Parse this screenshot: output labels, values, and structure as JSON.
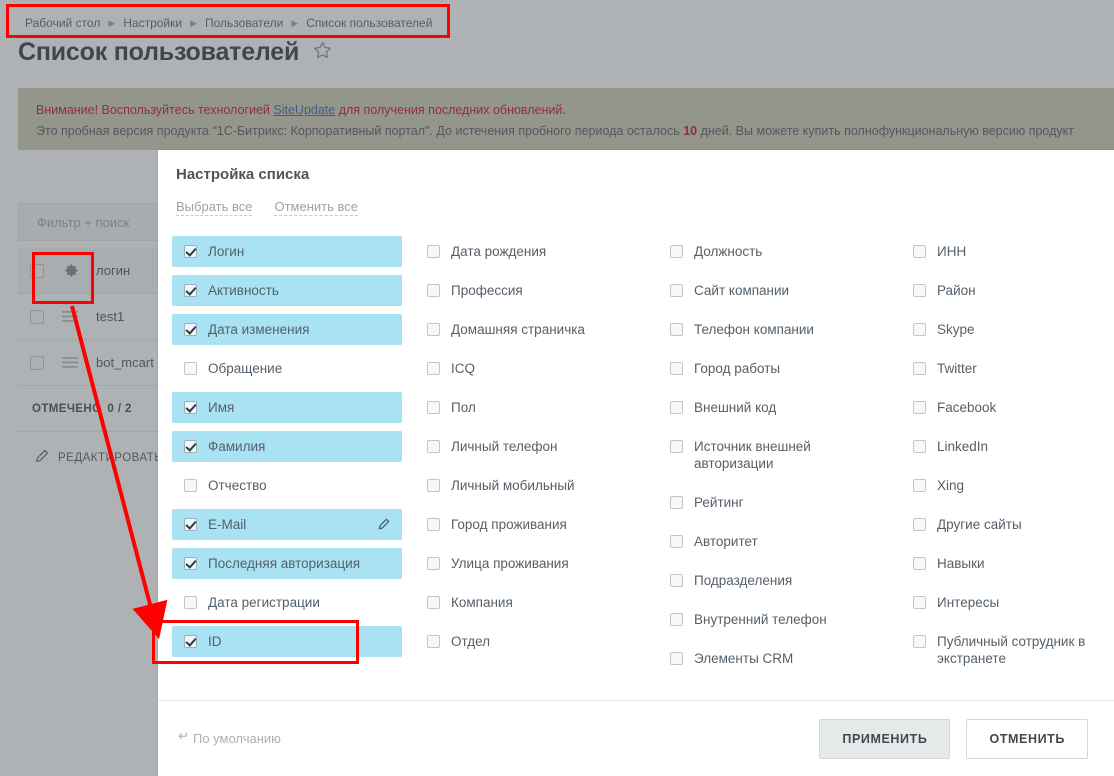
{
  "breadcrumb": {
    "items": [
      {
        "label": "Рабочий стол"
      },
      {
        "label": "Настройки"
      },
      {
        "label": "Пользователи"
      },
      {
        "label": "Список пользователей"
      }
    ],
    "separator": "▶"
  },
  "header": {
    "title": "Список пользователей",
    "favorite_icon": "star-icon"
  },
  "warning": {
    "line1_prefix": "Внимание! Воспользуйтесь технологией ",
    "line1_link": "SiteUpdate",
    "line1_suffix": " для получения последних обновлений.",
    "line2_prefix": "Это пробная версия продукта \"1С-Битрикс: Корпоративный портал\". До истечения пробного периода осталось ",
    "line2_days": "10",
    "line2_suffix": " дней. Вы можете купить полнофункциональную версию продукт"
  },
  "background_table": {
    "filter_placeholder": "Фильтр + поиск",
    "header_gear_icon": "gear-icon",
    "header_login_label": "логин",
    "rows": [
      {
        "grip_icon": "grip-icon",
        "login": "test1"
      },
      {
        "grip_icon": "grip-icon",
        "login": "bot_mcart"
      }
    ],
    "marked_label": "ОТМЕЧЕНО",
    "marked_count": "0 / 2",
    "edit_icon": "pencil-icon",
    "edit_label": "РЕДАКТИРОВАТЬ"
  },
  "dialog": {
    "title": "Настройка списка",
    "select_all": "Выбрать все",
    "deselect_all": "Отменить все",
    "columns": [
      {
        "options": [
          {
            "label": "Логин",
            "checked": true
          },
          {
            "label": "Активность",
            "checked": true
          },
          {
            "label": "Дата изменения",
            "checked": true
          },
          {
            "label": "Обращение",
            "checked": false
          },
          {
            "label": "Имя",
            "checked": true
          },
          {
            "label": "Фамилия",
            "checked": true
          },
          {
            "label": "Отчество",
            "checked": false
          },
          {
            "label": "E-Mail",
            "checked": true,
            "icon": "pencil-icon"
          },
          {
            "label": "Последняя авторизация",
            "checked": true
          },
          {
            "label": "Дата регистрации",
            "checked": false
          },
          {
            "label": "ID",
            "checked": true
          }
        ]
      },
      {
        "options": [
          {
            "label": "Дата рождения",
            "checked": false
          },
          {
            "label": "Профессия",
            "checked": false
          },
          {
            "label": "Домашняя страничка",
            "checked": false
          },
          {
            "label": "ICQ",
            "checked": false
          },
          {
            "label": "Пол",
            "checked": false
          },
          {
            "label": "Личный телефон",
            "checked": false
          },
          {
            "label": "Личный мобильный",
            "checked": false
          },
          {
            "label": "Город проживания",
            "checked": false
          },
          {
            "label": "Улица проживания",
            "checked": false
          },
          {
            "label": "Компания",
            "checked": false
          },
          {
            "label": "Отдел",
            "checked": false
          }
        ]
      },
      {
        "options": [
          {
            "label": "Должность",
            "checked": false
          },
          {
            "label": "Сайт компании",
            "checked": false
          },
          {
            "label": "Телефон компании",
            "checked": false
          },
          {
            "label": "Город работы",
            "checked": false
          },
          {
            "label": "Внешний код",
            "checked": false
          },
          {
            "label": "Источник внешней авторизации",
            "checked": false
          },
          {
            "label": "Рейтинг",
            "checked": false
          },
          {
            "label": "Авторитет",
            "checked": false
          },
          {
            "label": "Подразделения",
            "checked": false
          },
          {
            "label": "Внутренний телефон",
            "checked": false
          },
          {
            "label": "Элементы CRM",
            "checked": false
          }
        ]
      },
      {
        "options": [
          {
            "label": "ИНН",
            "checked": false
          },
          {
            "label": "Район",
            "checked": false
          },
          {
            "label": "Skype",
            "checked": false
          },
          {
            "label": "Twitter",
            "checked": false
          },
          {
            "label": "Facebook",
            "checked": false
          },
          {
            "label": "LinkedIn",
            "checked": false
          },
          {
            "label": "Xing",
            "checked": false
          },
          {
            "label": "Другие сайты",
            "checked": false
          },
          {
            "label": "Навыки",
            "checked": false
          },
          {
            "label": "Интересы",
            "checked": false
          },
          {
            "label": "Публичный сотрудник в экстранете",
            "checked": false
          }
        ]
      }
    ],
    "footer": {
      "default_icon": "return-arrow-icon",
      "default_label": "По умолчанию",
      "apply_label": "ПРИМЕНИТЬ",
      "cancel_label": "ОТМЕНИТЬ"
    }
  },
  "annotations": {
    "color": "#ff0000",
    "boxes": [
      {
        "name": "breadcrumb-highlight"
      },
      {
        "name": "gear-icon-highlight"
      },
      {
        "name": "id-option-highlight"
      }
    ],
    "arrow": {
      "name": "pointer-arrow",
      "from": "gear-icon",
      "to": "id-option"
    }
  }
}
